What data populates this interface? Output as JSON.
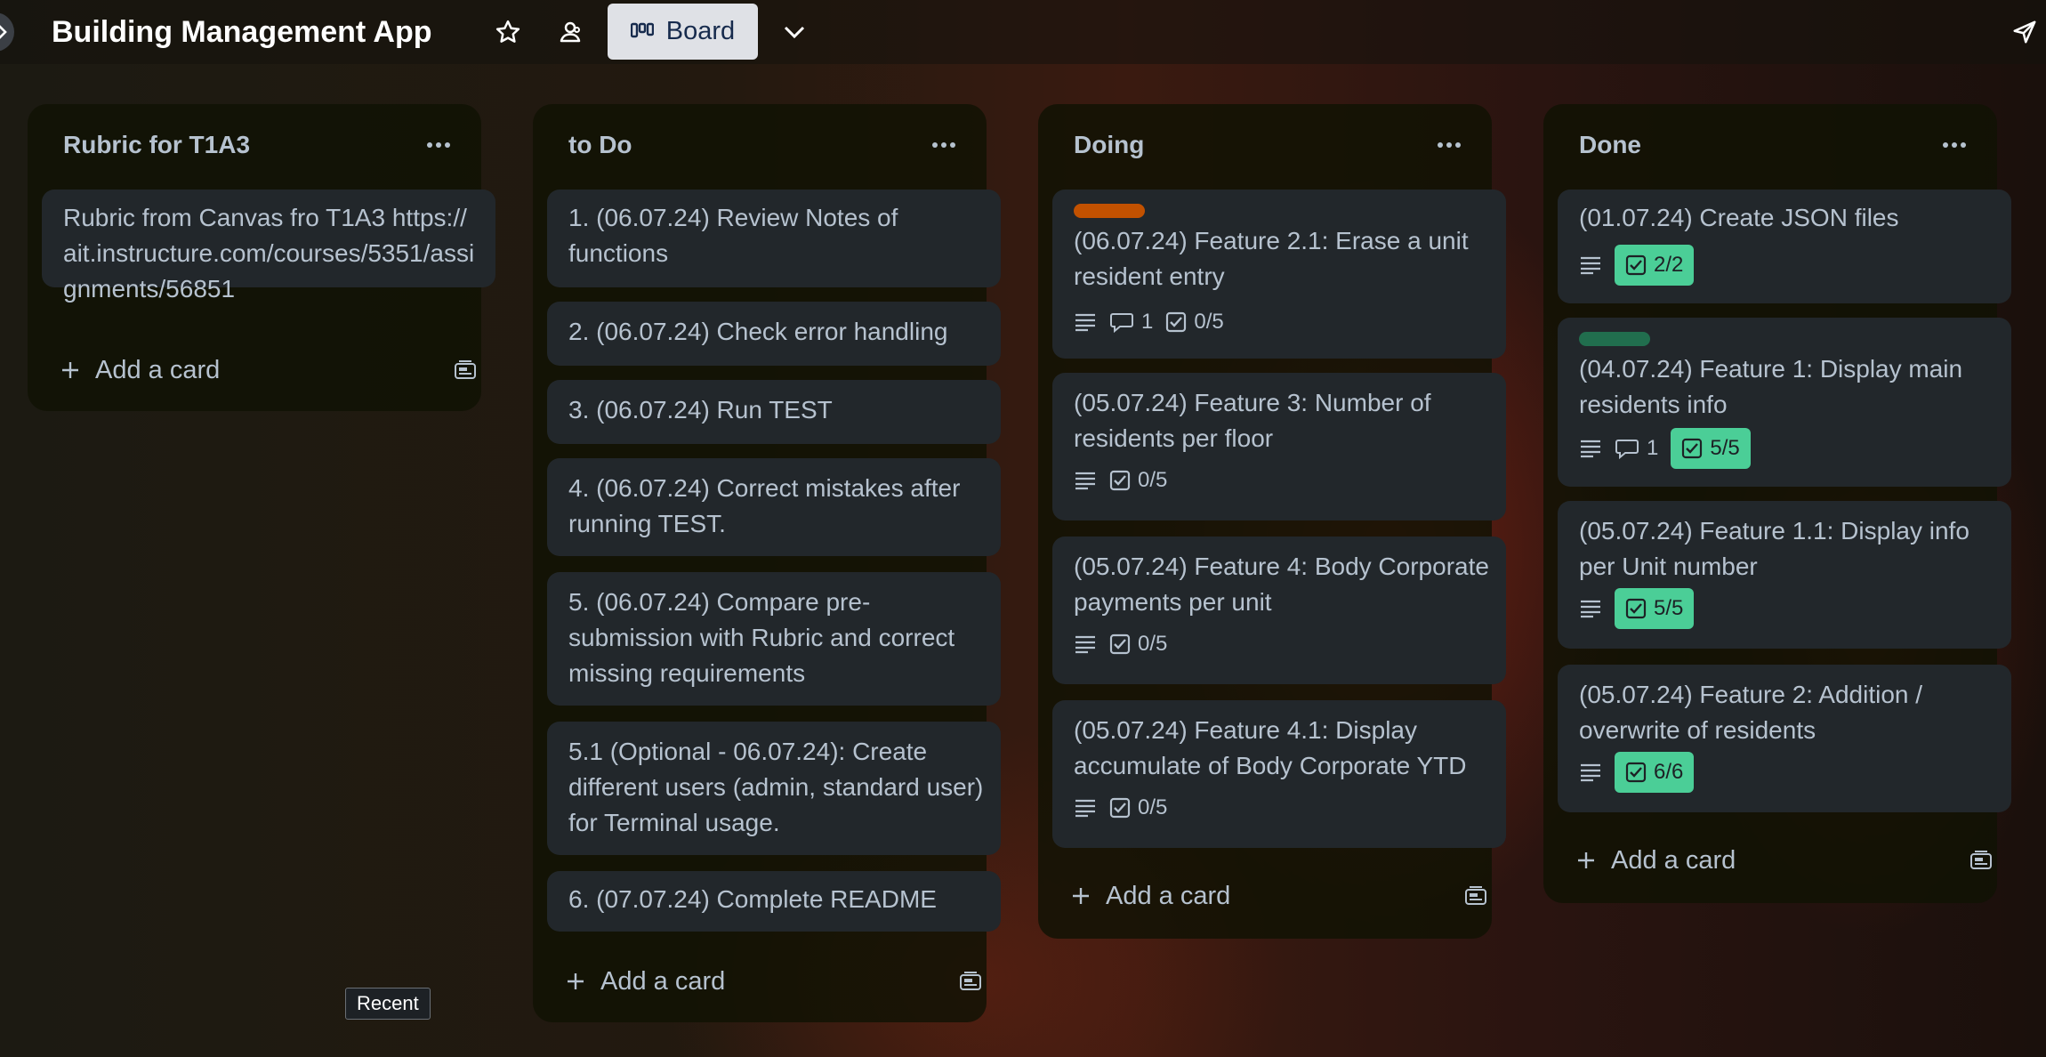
{
  "board": {
    "title": "Building Management App",
    "view_button_label": "Board"
  },
  "colors": {
    "label_orange": "#c25100",
    "label_green": "#216e4e",
    "checklist_complete": "#4bce97"
  },
  "icons": [
    "chevron-right-icon",
    "star-icon",
    "workspace-visibility-icon",
    "board-icon",
    "chevron-down-icon",
    "send-icon",
    "more-icon",
    "plus-icon",
    "template-icon",
    "description-icon",
    "comment-icon",
    "checklist-icon"
  ],
  "lists": [
    {
      "title": "Rubric for T1A3",
      "add_label": "Add a card",
      "cards": [
        {
          "text": "Rubric from Canvas fro T1A3 https://ait.instructure.com/courses/5351/assignments/56851"
        }
      ]
    },
    {
      "title": "to Do",
      "add_label": "Add a card",
      "cards": [
        {
          "text": "1. (06.07.24) Review Notes of functions"
        },
        {
          "text": "2. (06.07.24) Check error handling"
        },
        {
          "text": "3. (06.07.24) Run TEST"
        },
        {
          "text": "4. (06.07.24) Correct mistakes after running TEST."
        },
        {
          "text": "5. (06.07.24) Compare pre-submission with Rubric and correct missing requirements"
        },
        {
          "text": "5.1 (Optional - 06.07.24): Create different users (admin, standard user) for Terminal usage."
        },
        {
          "text": "6. (07.07.24) Complete README"
        }
      ]
    },
    {
      "title": "Doing",
      "add_label": "Add a card",
      "cards": [
        {
          "text": "(06.07.24) Feature 2.1: Erase a unit resident entry",
          "label": "orange",
          "comments": "1",
          "checklist": "0/5"
        },
        {
          "text": "(05.07.24) Feature 3: Number of residents per floor",
          "checklist": "0/5"
        },
        {
          "text": "(05.07.24) Feature 4: Body Corporate payments per unit",
          "checklist": "0/5"
        },
        {
          "text": "(05.07.24) Feature 4.1: Display accumulate of Body Corporate YTD",
          "checklist": "0/5"
        }
      ]
    },
    {
      "title": "Done",
      "add_label": "Add a card",
      "cards": [
        {
          "text": "(01.07.24) Create JSON files",
          "checklist": "2/2"
        },
        {
          "text": "(04.07.24) Feature 1: Display main residents info",
          "label": "green",
          "comments": "1",
          "checklist": "5/5"
        },
        {
          "text": "(05.07.24) Feature 1.1: Display info per Unit number",
          "checklist": "5/5"
        },
        {
          "text": "(05.07.24) Feature 2: Addition / overwrite of residents",
          "checklist": "6/6"
        }
      ]
    }
  ],
  "tooltip": {
    "text": "Recent"
  }
}
